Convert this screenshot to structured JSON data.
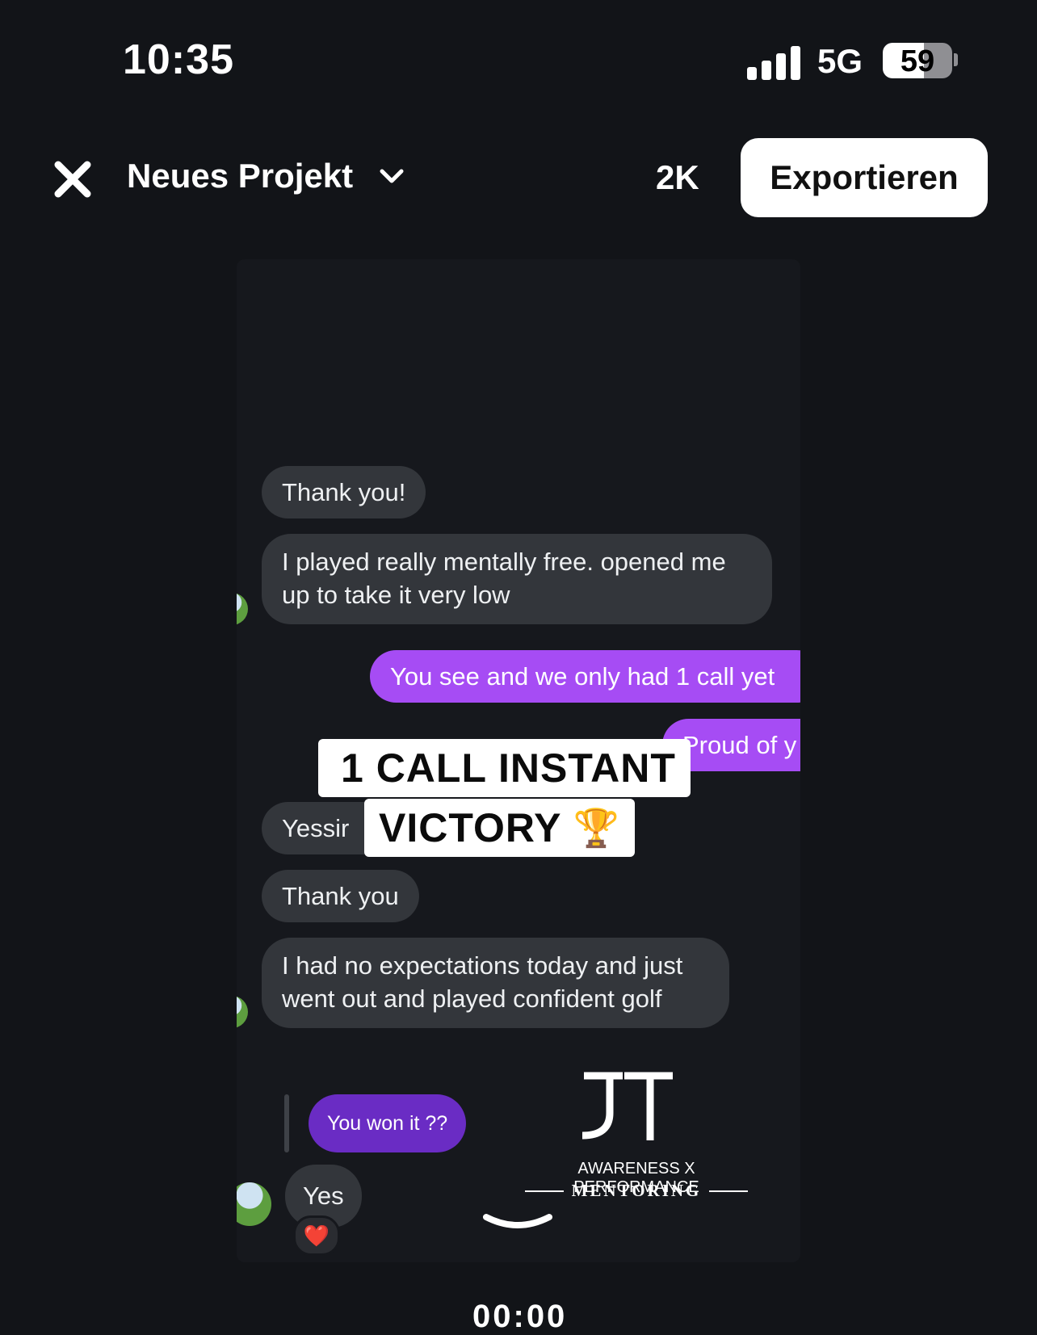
{
  "status_bar": {
    "time": "10:35",
    "network": "5G",
    "battery": "59",
    "battery_level": 0.59
  },
  "top_bar": {
    "project_title": "Neues Projekt",
    "resolution": "2K",
    "export_label": "Exportieren"
  },
  "preview": {
    "messages": [
      {
        "text": "Thank you!",
        "direction": "incoming"
      },
      {
        "text": "I played really mentally free. opened me",
        "text2": "up to take it very low",
        "direction": "incoming"
      },
      {
        "text": "You see and we only had 1 call yet",
        "direction": "outgoing"
      },
      {
        "text": "Proud of y",
        "direction": "outgoing"
      },
      {
        "text": "Yessir",
        "direction": "incoming"
      },
      {
        "text": "Thank you",
        "direction": "incoming"
      },
      {
        "text": "I had no expectations today and just",
        "text2": "went out and played confident golf",
        "direction": "incoming"
      },
      {
        "text": "You won it ??",
        "direction": "outgoing-quoted"
      },
      {
        "text": "Yes",
        "direction": "incoming"
      }
    ],
    "reaction": "❤️",
    "overlay": {
      "line1": "1 CALL INSTANT",
      "line2": "VICTORY",
      "emoji": "🏆"
    },
    "logo": {
      "mark": "JT",
      "line1": "AWARENESS X PERFORMANCE",
      "line2": "MENTORING"
    }
  },
  "timeline": {
    "current_time": "00:00"
  },
  "colors": {
    "background": "#121418",
    "incoming_bubble": "#33363b",
    "outgoing_bubble": "#a64cf4",
    "quoted_bubble": "#6a2cc4"
  }
}
